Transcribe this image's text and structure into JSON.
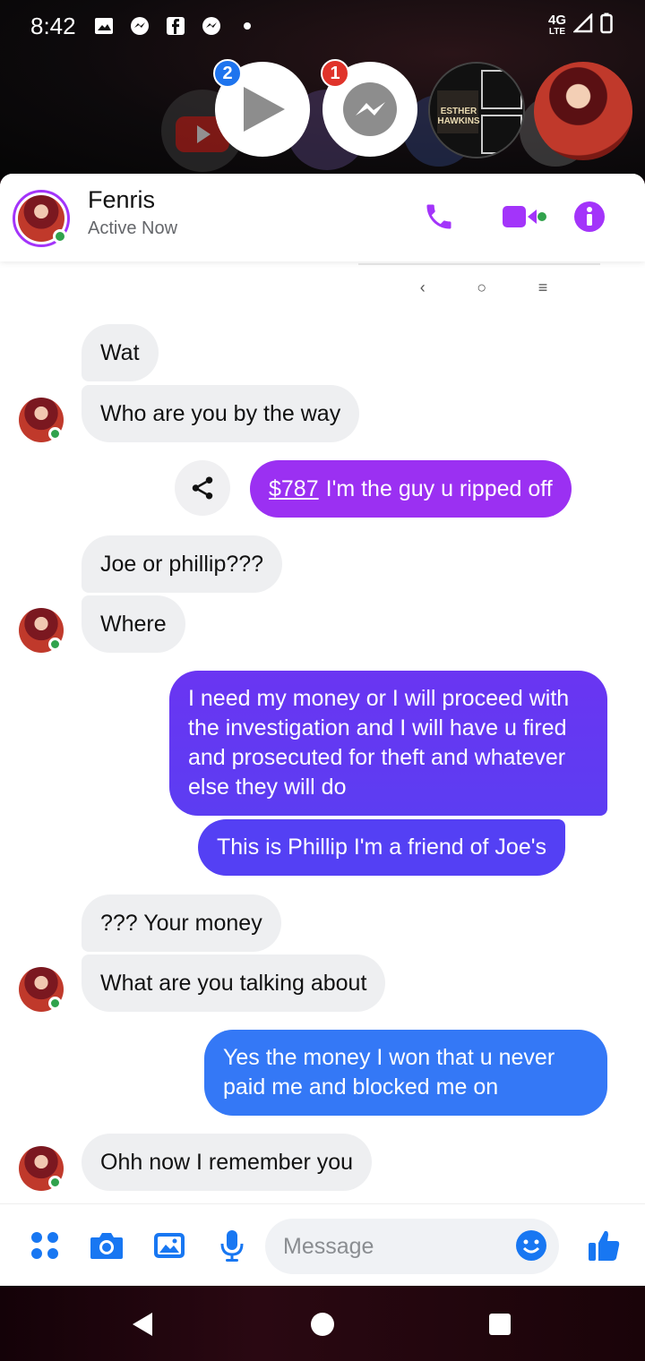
{
  "status_bar": {
    "time": "8:42",
    "network": "4G",
    "network_sub": "LTE",
    "icons": [
      "image-icon",
      "messenger-icon",
      "facebook-icon",
      "messenger-icon",
      "dot-icon"
    ]
  },
  "bubble_heads": [
    {
      "name": "youtube-head",
      "badge": ""
    },
    {
      "name": "play-head",
      "badge": "2"
    },
    {
      "name": "messenger-head",
      "badge": "1"
    },
    {
      "name": "esther-hawkins-head",
      "badge": ""
    },
    {
      "name": "contact-avatar-head",
      "badge": ""
    }
  ],
  "bubble_art_text": "ESTHER HAWKINS",
  "header": {
    "name": "Fenris",
    "status": "Active Now"
  },
  "messages": [
    {
      "id": "m1",
      "from": "them",
      "text": "Wat"
    },
    {
      "id": "m2",
      "from": "them",
      "text": "Who are you by the way"
    },
    {
      "id": "m3",
      "from": "me",
      "link": "$787",
      "text": "I'm the guy u ripped off"
    },
    {
      "id": "m4",
      "from": "them",
      "text": "Joe  or phillip???"
    },
    {
      "id": "m5",
      "from": "them",
      "text": "Where"
    },
    {
      "id": "m6",
      "from": "me",
      "text": "I need my money or I will proceed with the investigation and I will have u fired and prosecuted for theft and whatever else they will do"
    },
    {
      "id": "m7",
      "from": "me",
      "text": "This is Phillip I'm a friend of Joe's"
    },
    {
      "id": "m8",
      "from": "them",
      "text": "??? Your money"
    },
    {
      "id": "m9",
      "from": "them",
      "text": "What are you talking about"
    },
    {
      "id": "m10",
      "from": "me",
      "text": "Yes the money I won that u never paid me and blocked me on"
    },
    {
      "id": "m11",
      "from": "them",
      "text": "Ohh now I remember  you"
    }
  ],
  "composer": {
    "placeholder": "Message"
  },
  "colors": {
    "accent": "#a334fa",
    "out_purple": "#9b30f2",
    "out_indigo": "#5e3bf3",
    "out_blue": "#3478f6",
    "online": "#31a24c"
  }
}
